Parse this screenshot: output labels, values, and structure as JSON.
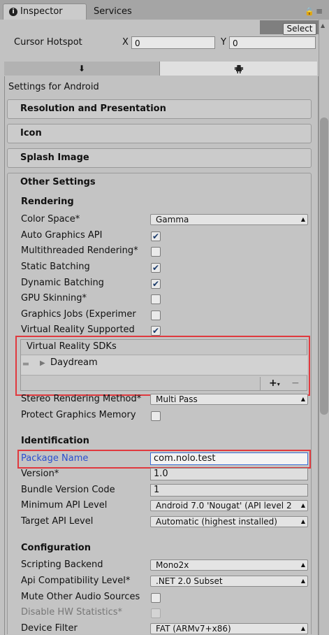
{
  "tabs": {
    "inspector": "Inspector",
    "services": "Services"
  },
  "header": {
    "select_label": "Select",
    "cursor_hotspot_label": "Cursor Hotspot",
    "x_label": "X",
    "x_value": "0",
    "y_label": "Y",
    "y_value": "0"
  },
  "platform_tabs": {
    "standalone_icon": "⬇",
    "android_icon": "android-icon"
  },
  "settings_for": "Settings for Android",
  "foldouts": {
    "resolution": "Resolution and Presentation",
    "icon": "Icon",
    "splash": "Splash Image",
    "other": "Other Settings"
  },
  "rendering": {
    "title": "Rendering",
    "color_space_label": "Color Space*",
    "color_space_value": "Gamma",
    "auto_graphics_label": "Auto Graphics API",
    "auto_graphics": true,
    "multithreaded_label": "Multithreaded Rendering*",
    "multithreaded": false,
    "static_batching_label": "Static Batching",
    "static_batching": true,
    "dynamic_batching_label": "Dynamic Batching",
    "dynamic_batching": true,
    "gpu_skinning_label": "GPU Skinning*",
    "gpu_skinning": false,
    "graphics_jobs_label": "Graphics Jobs (Experimer",
    "graphics_jobs": false,
    "vr_supported_label": "Virtual Reality Supported",
    "vr_supported": true,
    "vr_sdks_header": "Virtual Reality SDKs",
    "vr_sdk_items": [
      "Daydream"
    ],
    "stereo_label": "Stereo Rendering Method*",
    "stereo_value": "Multi Pass",
    "protect_memory_label": "Protect Graphics Memory",
    "protect_memory": false
  },
  "identification": {
    "title": "Identification",
    "package_label": "Package Name",
    "package_value": "com.nolo.test",
    "version_label": "Version*",
    "version_value": "1.0",
    "bundle_label": "Bundle Version Code",
    "bundle_value": "1",
    "min_api_label": "Minimum API Level",
    "min_api_value": "Android 7.0 'Nougat' (API level 2",
    "target_api_label": "Target API Level",
    "target_api_value": "Automatic (highest installed)"
  },
  "configuration": {
    "title": "Configuration",
    "backend_label": "Scripting Backend",
    "backend_value": "Mono2x",
    "api_compat_label": "Api Compatibility Level*",
    "api_compat_value": ".NET 2.0 Subset",
    "mute_label": "Mute Other Audio Sources",
    "mute": false,
    "disable_hw_label": "Disable HW Statistics*",
    "disable_hw": false,
    "device_filter_label": "Device Filter",
    "device_filter_value": "FAT (ARMv7+x86)"
  }
}
